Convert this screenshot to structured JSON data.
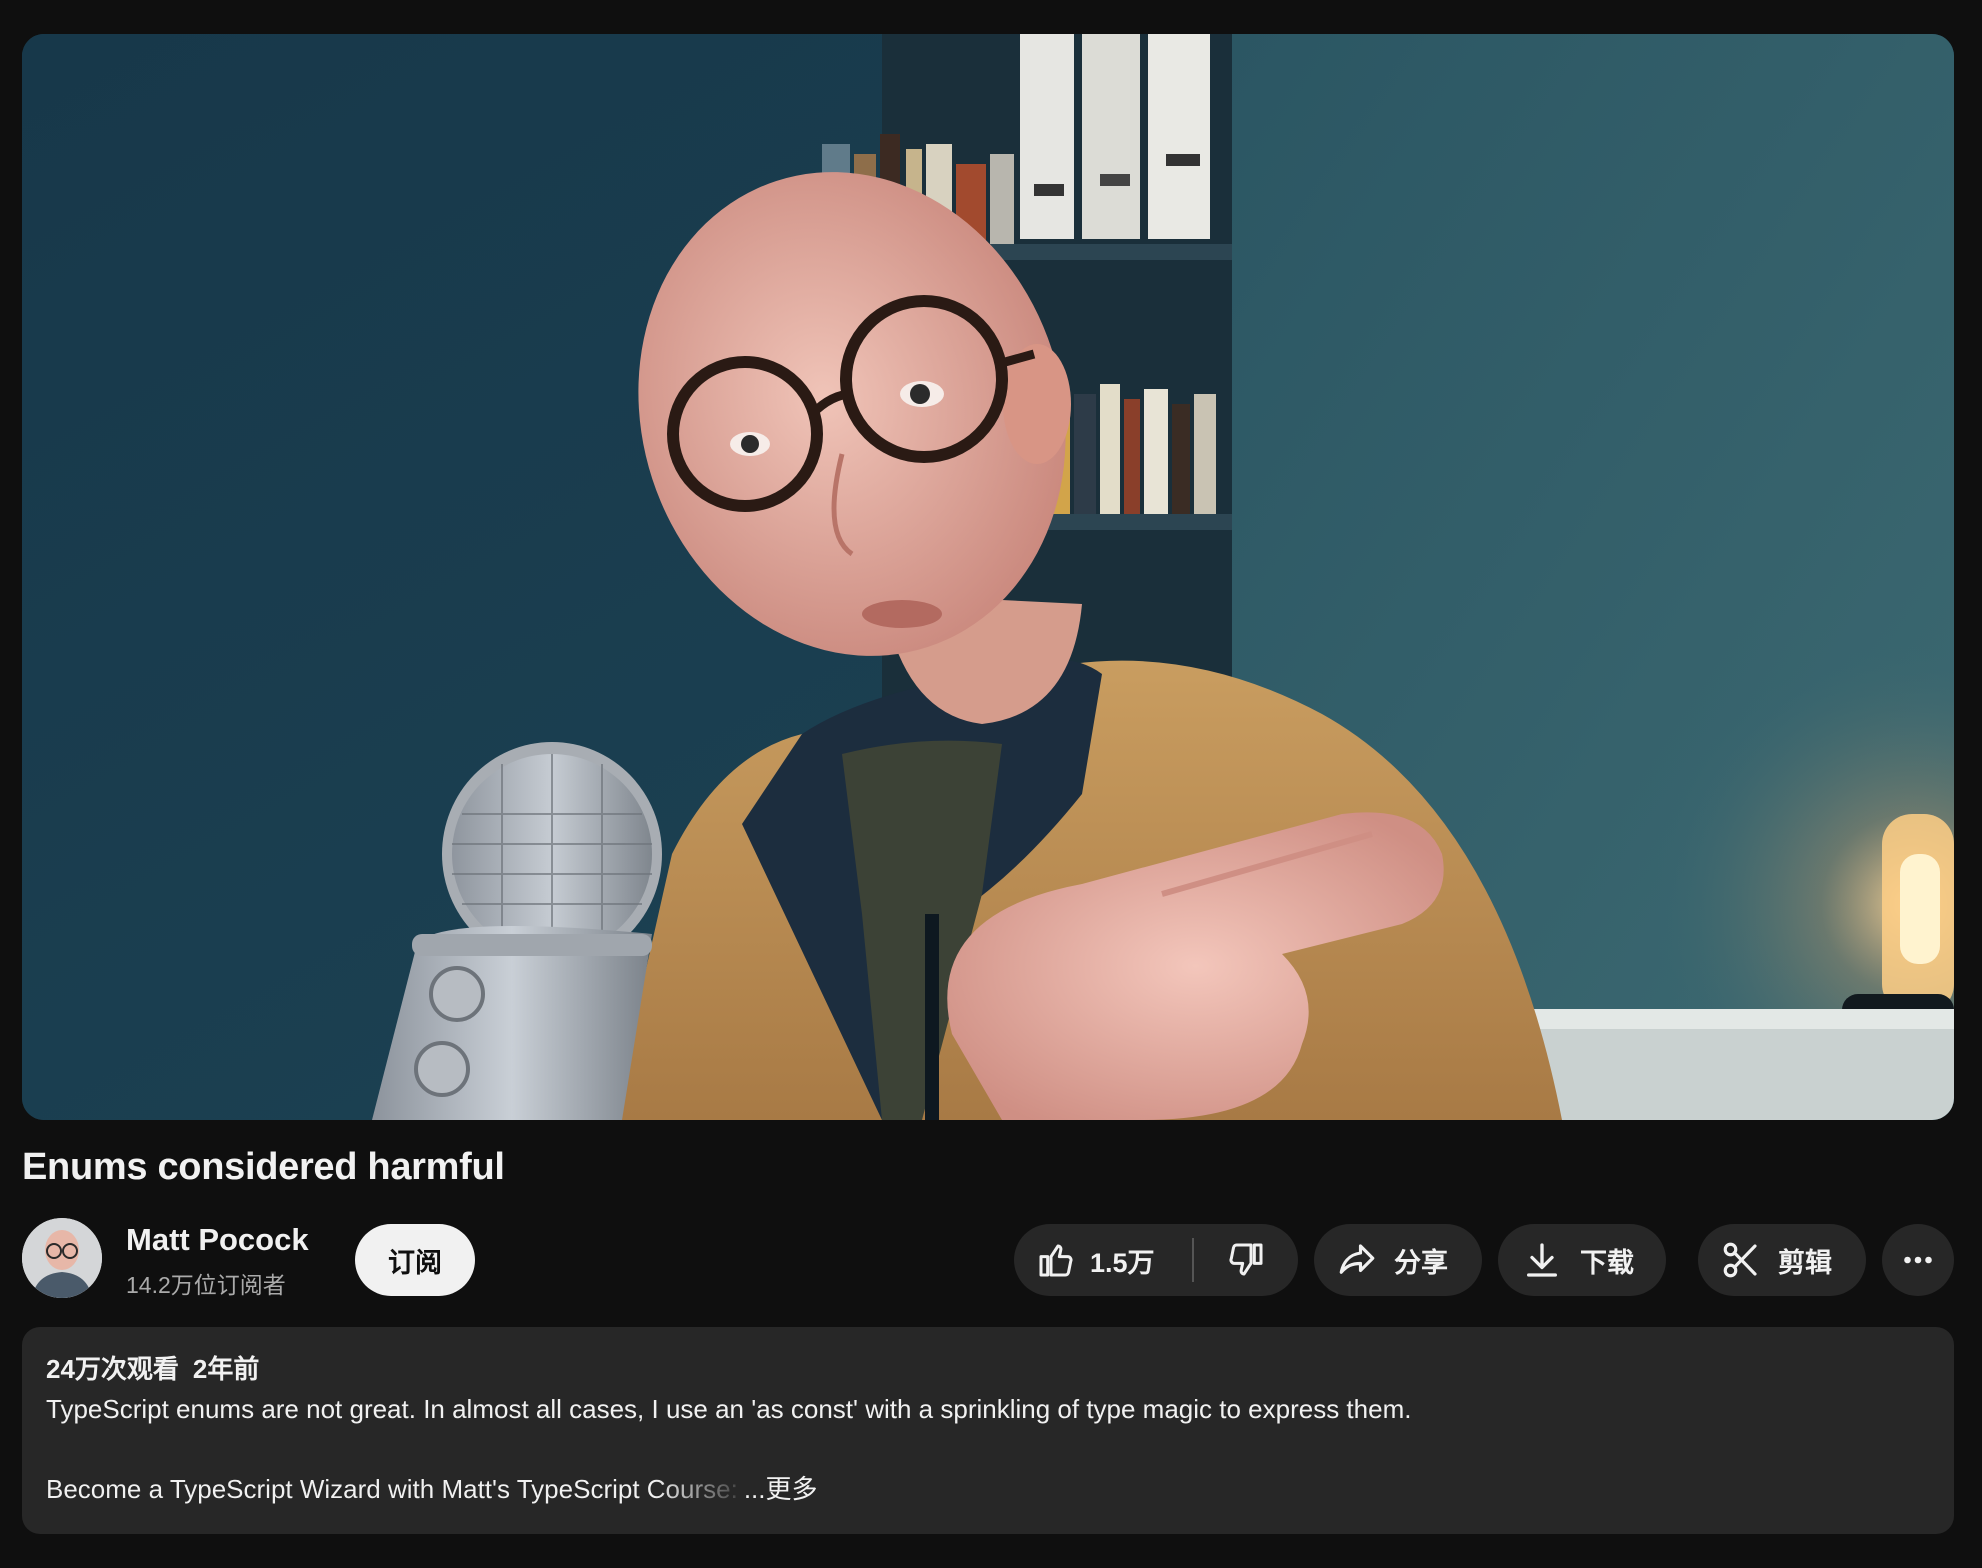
{
  "video": {
    "title": "Enums considered harmful"
  },
  "channel": {
    "name": "Matt Pocock",
    "subscribers": "14.2万位订阅者",
    "subscribe_label": "订阅"
  },
  "actions": {
    "like_count": "1.5万",
    "share_label": "分享",
    "download_label": "下载",
    "clip_label": "剪辑"
  },
  "description": {
    "views": "24万次观看",
    "age": "2年前",
    "line1": "TypeScript enums are not great. In almost all cases, I use an 'as const' with a sprinkling of type magic to express them.",
    "line2": "Become a TypeScript Wizard with Matt's TypeScript Course:",
    "more_label": "...更多"
  },
  "colors": {
    "background": "#0f0f0f",
    "pill": "#272727",
    "text": "#f1f1f1",
    "secondary_text": "#aaaaaa",
    "subscribe_bg": "#f1f1f1"
  },
  "icons": [
    "thumbs-up-icon",
    "thumbs-down-icon",
    "share-icon",
    "download-icon",
    "scissors-icon",
    "more-horizontal-icon"
  ]
}
